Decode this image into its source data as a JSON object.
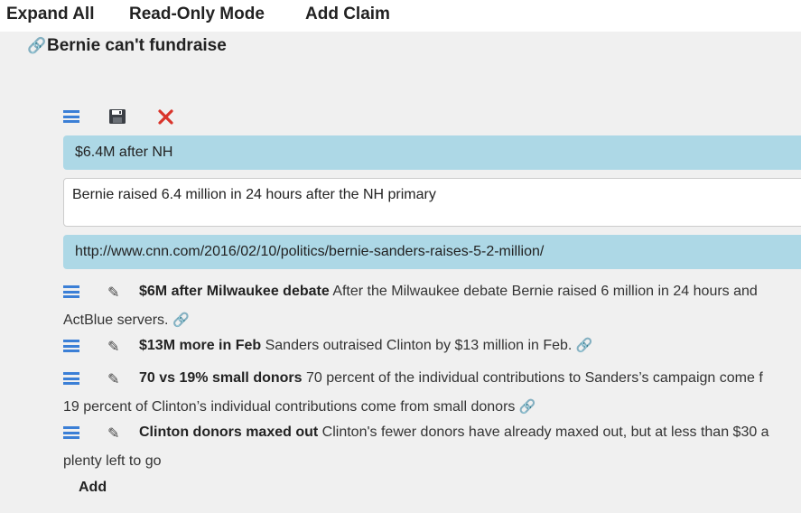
{
  "toolbar": {
    "expand_all": "Expand All",
    "read_only_mode": "Read-Only Mode",
    "add_claim": "Add Claim"
  },
  "claim": {
    "title": "Bernie can't fundraise"
  },
  "editor": {
    "title_value": "$6.4M after NH",
    "body_value": "Bernie raised 6.4 million in 24 hours after the NH primary",
    "url_value": "http://www.cnn.com/2016/02/10/politics/bernie-sanders-raises-5-2-million/"
  },
  "evidence": [
    {
      "title": "$6M after Milwaukee debate",
      "text": "After the Milwaukee debate Bernie raised 6 million in 24 hours and",
      "text_cont": "ActBlue servers."
    },
    {
      "title": "$13M more in Feb",
      "text": "Sanders outraised Clinton by $13 million in Feb."
    },
    {
      "title": "70 vs 19% small donors",
      "text": "70 percent of the individual contributions to Sanders’s campaign come f",
      "text_cont": "19 percent of Clinton’s individual contributions come from small donors"
    },
    {
      "title": "Clinton donors maxed out",
      "text": "Clinton's fewer donors have already maxed out, but at less than $30 a",
      "text_cont": "plenty left to go"
    }
  ],
  "add_label": "Add",
  "colors": {
    "accent_blue": "#3b7fd6",
    "field_blue": "#add8e6",
    "delete_red": "#d9342b",
    "background": "#f0f0f0"
  },
  "icons": {
    "link": "link-icon",
    "menu": "hamburger-icon",
    "save": "floppy-disk-icon",
    "delete": "close-icon",
    "edit": "pencil-icon"
  }
}
